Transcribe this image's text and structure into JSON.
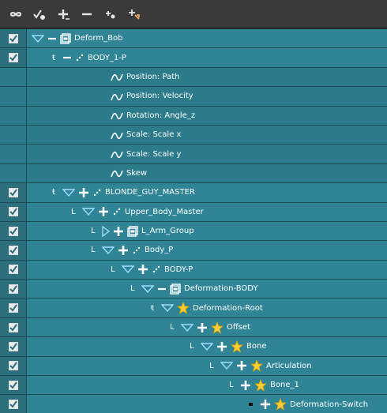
{
  "toolbar": {
    "buttons": [
      {
        "name": "infinity-icon"
      },
      {
        "name": "check-add-icon"
      },
      {
        "name": "plus-icon"
      },
      {
        "name": "minus-icon"
      },
      {
        "name": "add-keyframe-icon"
      },
      {
        "name": "add-peg-icon"
      }
    ]
  },
  "rows": [
    {
      "label": "Deform_Bob",
      "type": "group",
      "indent": 0,
      "expander": "down",
      "prefix": "minus",
      "checked": true
    },
    {
      "label": "BODY_1-P",
      "type": "peg",
      "indent": 1,
      "expander": "none",
      "prefix": "minus",
      "connector": "+",
      "checked": true
    },
    {
      "label": "Position: Path",
      "type": "function",
      "indent": 4,
      "checked": false
    },
    {
      "label": "Position: Velocity",
      "type": "function",
      "indent": 4,
      "checked": false
    },
    {
      "label": "Rotation: Angle_z",
      "type": "function",
      "indent": 4,
      "checked": false
    },
    {
      "label": "Scale: Scale x",
      "type": "function",
      "indent": 4,
      "checked": false
    },
    {
      "label": "Scale: Scale y",
      "type": "function",
      "indent": 4,
      "checked": false
    },
    {
      "label": "Skew",
      "type": "function",
      "indent": 4,
      "checked": false
    },
    {
      "label": "BLONDE_GUY_MASTER",
      "type": "peg",
      "indent": 1,
      "expander": "down",
      "prefix": "plus",
      "connector": "+",
      "checked": true
    },
    {
      "label": "Upper_Body_Master",
      "type": "peg",
      "indent": 2,
      "expander": "down",
      "prefix": "plus",
      "connector": "L",
      "checked": true
    },
    {
      "label": "L_Arm_Group",
      "type": "group",
      "indent": 3,
      "expander": "right",
      "prefix": "plus",
      "connector": "L",
      "checked": true
    },
    {
      "label": "Body_P",
      "type": "peg",
      "indent": 3,
      "expander": "down",
      "prefix": "plus",
      "connector": "L",
      "checked": true
    },
    {
      "label": "BODY-P",
      "type": "peg",
      "indent": 4,
      "expander": "down",
      "prefix": "plus",
      "connector": "L",
      "checked": true
    },
    {
      "label": "Deformation-BODY",
      "type": "group",
      "indent": 5,
      "expander": "down",
      "prefix": "minus",
      "connector": "L",
      "checked": true
    },
    {
      "label": "Deformation-Root",
      "type": "star",
      "indent": 6,
      "expander": "down",
      "prefix": "none",
      "connector": "+",
      "checked": true
    },
    {
      "label": "Offset",
      "type": "star",
      "indent": 7,
      "expander": "down",
      "prefix": "plus",
      "connector": "L",
      "checked": true
    },
    {
      "label": "Bone",
      "type": "star",
      "indent": 8,
      "expander": "down",
      "prefix": "plus",
      "connector": "L",
      "checked": true
    },
    {
      "label": "Articulation",
      "type": "star",
      "indent": 9,
      "expander": "down",
      "prefix": "plus",
      "connector": "L",
      "checked": true
    },
    {
      "label": "Bone_1",
      "type": "star",
      "indent": 10,
      "expander": "none",
      "prefix": "plus",
      "connector": "L",
      "checked": true
    },
    {
      "label": "Deformation-Switch",
      "type": "star",
      "indent": 11,
      "expander": "none",
      "prefix": "plus",
      "connector": "bullet",
      "checked": true
    }
  ]
}
